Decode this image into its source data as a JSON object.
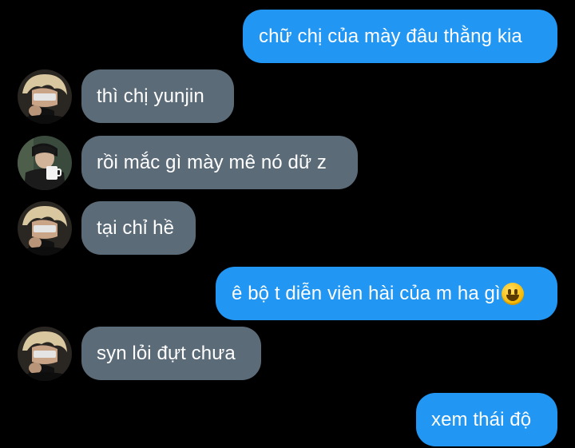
{
  "conversation": {
    "messages": [
      {
        "direction": "outgoing",
        "text": "chữ chị của mày đâu thằng kia"
      },
      {
        "direction": "incoming",
        "avatar": "blonde-masked-avatar",
        "text": "thì chị yunjin"
      },
      {
        "direction": "incoming",
        "avatar": "dark-hair-mug-avatar",
        "text": "rồi mắc gì mày mê nó dữ z"
      },
      {
        "direction": "incoming",
        "avatar": "blonde-masked-avatar",
        "text": "tại chỉ hề"
      },
      {
        "direction": "outgoing",
        "text": "ê bộ t diễn viên hài của m ha gì",
        "emoji": "grinning-face-emoji"
      },
      {
        "direction": "incoming",
        "avatar": "blonde-masked-avatar",
        "text": "syn lỏi đựt chưa"
      },
      {
        "direction": "outgoing",
        "text": "xem thái độ"
      }
    ]
  },
  "colors": {
    "background": "#000000",
    "outgoing_bubble": "#2196f3",
    "incoming_bubble": "#5c6b78",
    "bubble_text": "#ffffff"
  }
}
